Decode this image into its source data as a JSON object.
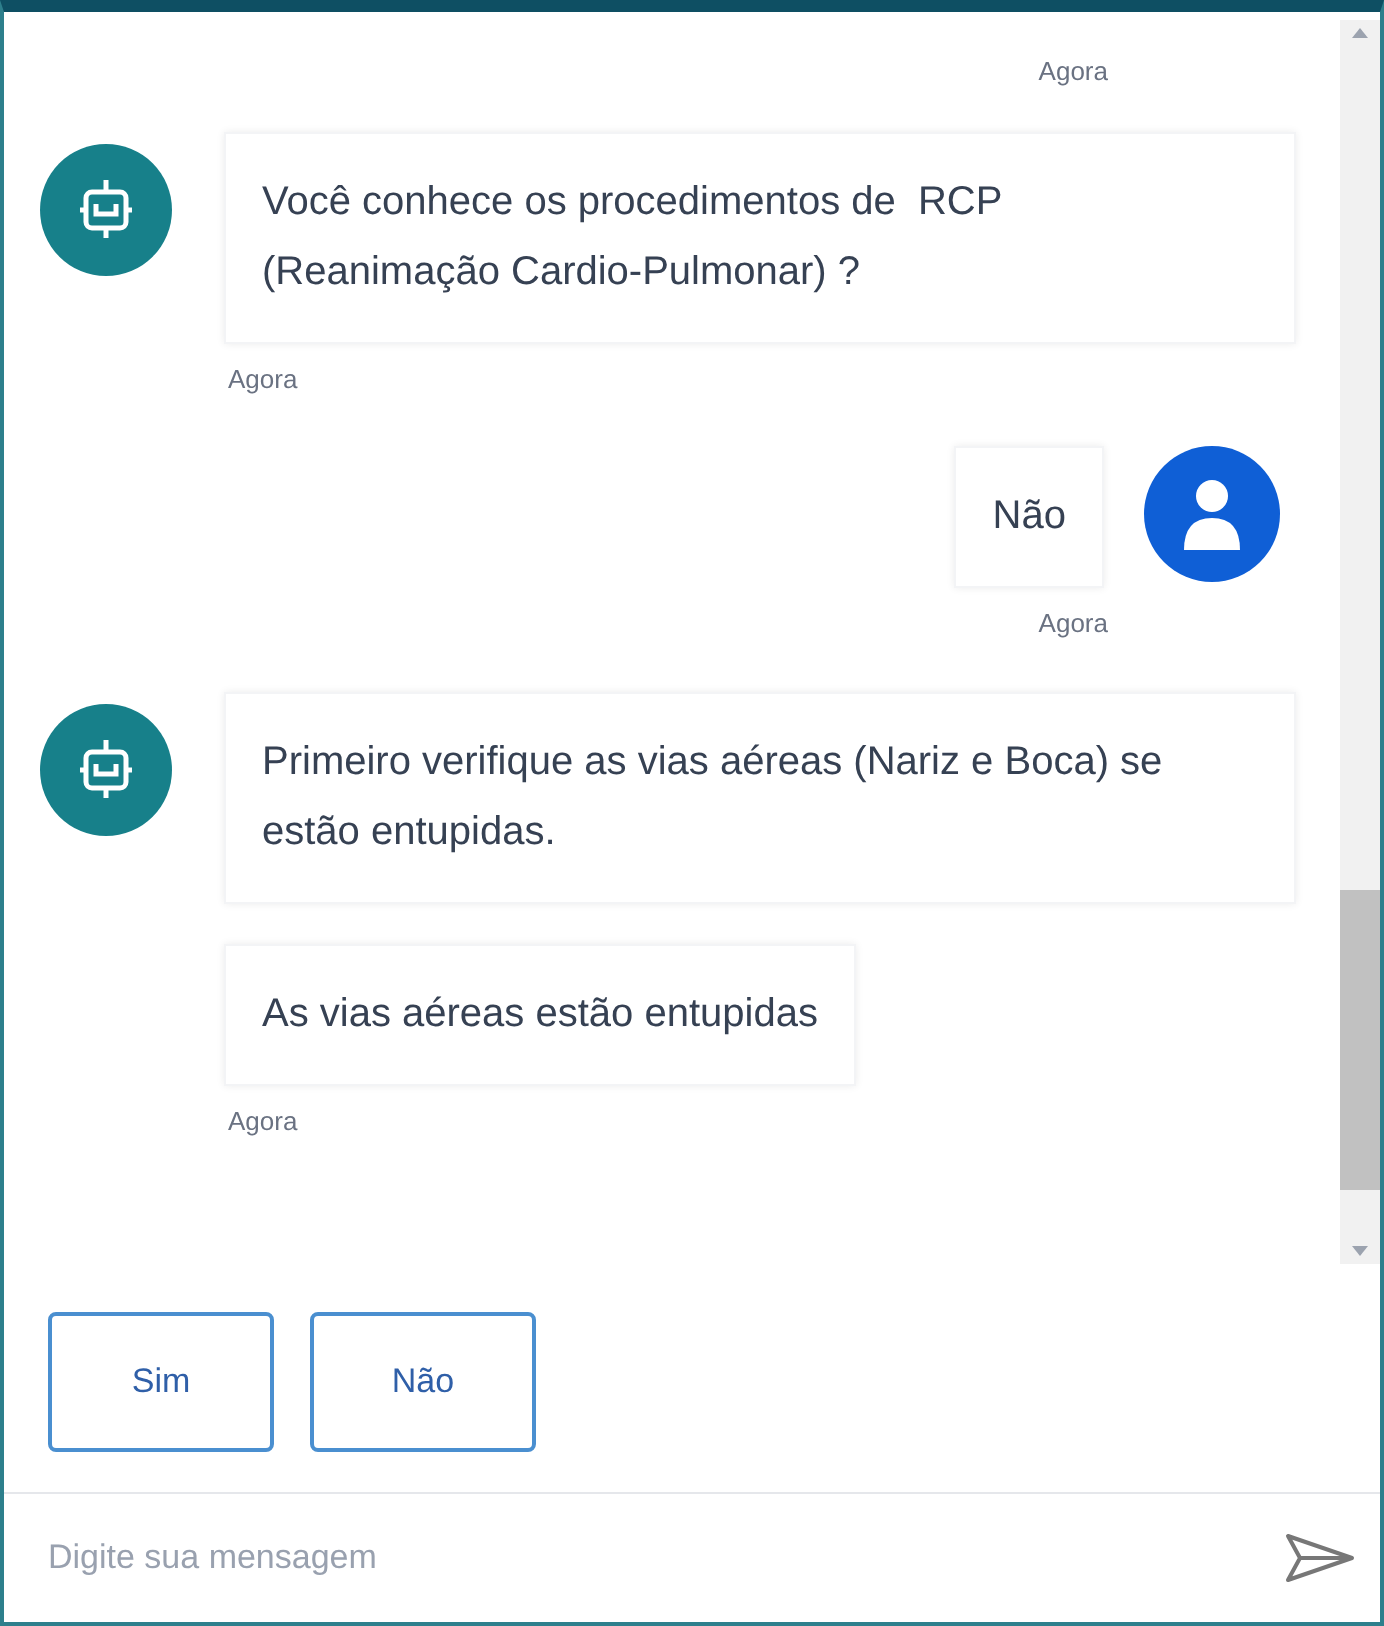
{
  "top_timestamp": "Agora",
  "messages": [
    {
      "kind": "bot",
      "bubbles": [
        "Você conhece os procedimentos de  RCP\n(Reanimação Cardio-Pulmonar) ?"
      ],
      "time": "Agora"
    },
    {
      "kind": "user",
      "bubbles": [
        "Não"
      ],
      "time": "Agora"
    },
    {
      "kind": "bot",
      "bubbles": [
        "Primeiro verifique as vias aéreas (Nariz e Boca) se estão entupidas.",
        "As vias aéreas estão entupidas"
      ],
      "time": "Agora"
    }
  ],
  "quick_replies": [
    "Sim",
    "Não"
  ],
  "composer": {
    "placeholder": "Digite sua mensagem"
  }
}
